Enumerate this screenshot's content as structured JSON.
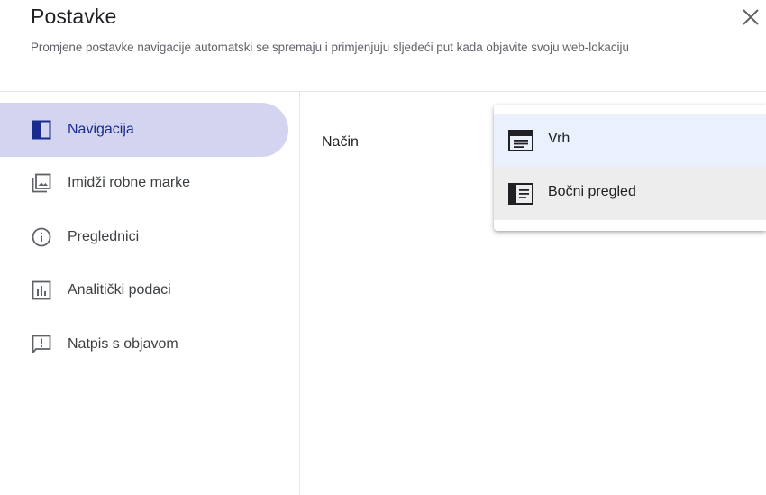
{
  "header": {
    "title": "Postavke",
    "subtitle": "Promjene postavke navigacije automatski se spremaju i primjenjuju sljedeći put kada objavite svoju web-lokaciju",
    "close_icon": "close-icon"
  },
  "sidebar": {
    "items": [
      {
        "label": "Navigacija",
        "icon": "navigation-panel-icon",
        "active": true
      },
      {
        "label": "Imidži robne marke",
        "icon": "image-library-icon",
        "active": false
      },
      {
        "label": "Preglednici",
        "icon": "info-icon",
        "active": false
      },
      {
        "label": "Analitički podaci",
        "icon": "analytics-icon",
        "active": false
      },
      {
        "label": "Natpis s objavom",
        "icon": "announcement-icon",
        "active": false
      }
    ]
  },
  "main": {
    "field_label": "Način",
    "dropdown": {
      "options": [
        {
          "label": "Vrh",
          "icon": "top-navigation-icon",
          "highlighted": true
        },
        {
          "label": "Bočni pregled",
          "icon": "side-navigation-icon",
          "hovered": true
        }
      ]
    }
  },
  "colors": {
    "active_nav_bg": "#d3d4ef",
    "active_nav_text": "#1a2b8f",
    "active_icon": "#1a2b8f",
    "option_highlight_bg": "#eaf0fc",
    "option_hover_bg": "#ededed"
  }
}
